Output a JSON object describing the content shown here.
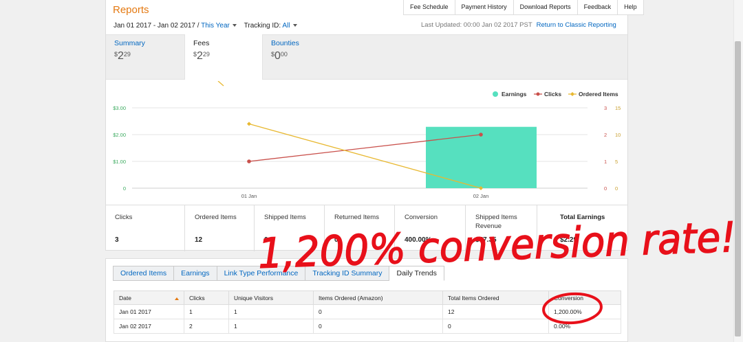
{
  "header": {
    "title": "Reports",
    "top_tabs": [
      "Fee Schedule",
      "Payment History",
      "Download Reports",
      "Feedback",
      "Help"
    ],
    "date_range": "Jan 01 2017 - Jan 02 2017",
    "date_separator": " / ",
    "period": "This Year",
    "tracking_label": "Tracking ID:",
    "tracking_value": "All",
    "last_updated": "Last Updated: 00:00 Jan 02 2017 PST",
    "classic_link": "Return to Classic Reporting"
  },
  "metrics": {
    "summary": {
      "label": "Summary",
      "currency": "$",
      "whole": "2",
      "cents": "29"
    },
    "fees": {
      "label": "Fees",
      "currency": "$",
      "whole": "2",
      "cents": "29"
    },
    "bounties": {
      "label": "Bounties",
      "currency": "$",
      "whole": "0",
      "cents": "00"
    }
  },
  "chart_data": {
    "type": "bar+line",
    "categories": [
      "01 Jan",
      "02 Jan"
    ],
    "series": [
      {
        "name": "Earnings",
        "kind": "bar",
        "axis": "left",
        "color": "#56e0bf",
        "values": [
          0,
          2.29
        ]
      },
      {
        "name": "Clicks",
        "kind": "line",
        "axis": "right1",
        "color": "#c9504b",
        "values": [
          1,
          2
        ]
      },
      {
        "name": "Ordered Items",
        "kind": "line",
        "axis": "right2",
        "color": "#e8b830",
        "values": [
          12,
          0
        ]
      }
    ],
    "left_ticks": [
      "0",
      "$1.00",
      "$2.00",
      "$3.00"
    ],
    "left_range": [
      0,
      3
    ],
    "right1_ticks": [
      "0",
      "1",
      "2",
      "3"
    ],
    "right1_range": [
      0,
      3
    ],
    "right2_ticks": [
      "0",
      "5",
      "10",
      "15"
    ],
    "right2_range": [
      0,
      15
    ],
    "legend_position": "top-right",
    "grid": true
  },
  "stats": [
    {
      "label": "Clicks",
      "value": "3"
    },
    {
      "label": "Ordered Items",
      "value": "12"
    },
    {
      "label": "Shipped Items",
      "value": "0"
    },
    {
      "label": "Returned Items",
      "value": "0"
    },
    {
      "label": "Conversion",
      "value": "400.00%"
    },
    {
      "label": "Shipped Items Revenue",
      "value": "$57.35"
    },
    {
      "label": "Total Earnings",
      "value": "$2.29"
    }
  ],
  "sub_tabs": [
    "Ordered Items",
    "Earnings",
    "Link Type Performance",
    "Tracking ID Summary",
    "Daily Trends"
  ],
  "table": {
    "columns": [
      "Date",
      "Clicks",
      "Unique Visitors",
      "Items Ordered (Amazon)",
      "Total Items Ordered",
      "Conversion"
    ],
    "rows": [
      [
        "Jan 01 2017",
        "1",
        "1",
        "0",
        "12",
        "1,200.00%"
      ],
      [
        "Jan 02 2017",
        "2",
        "1",
        "0",
        "0",
        "0.00%"
      ]
    ]
  },
  "annotation": {
    "text": "1,200% conversion rate!",
    "color": "#e8101a",
    "circled_value": "1,200.00%"
  }
}
